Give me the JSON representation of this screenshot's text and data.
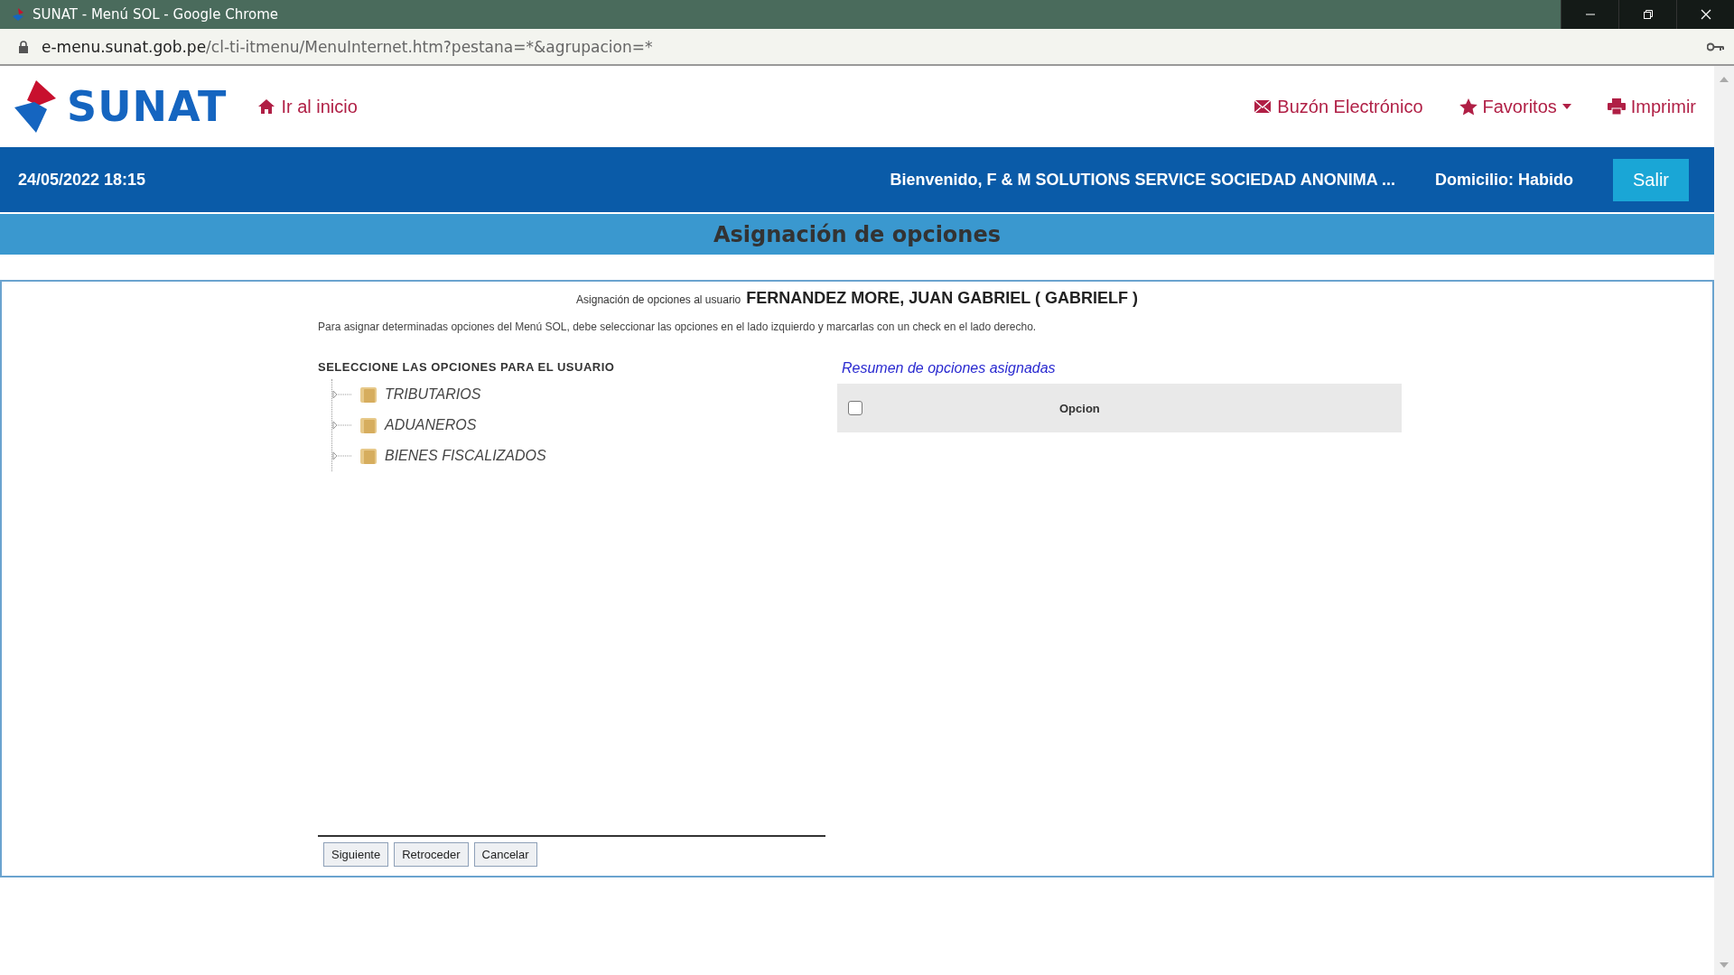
{
  "window": {
    "title": "SUNAT - Menú SOL - Google Chrome"
  },
  "address_bar": {
    "host": "e-menu.sunat.gob.pe",
    "path": "/cl-ti-itmenu/MenuInternet.htm?pestana=*&agrupacion=*"
  },
  "header": {
    "logo": "SUNAT",
    "home_link": "Ir al inicio",
    "links": [
      {
        "kind": "mail",
        "label": "Buzón Electrónico"
      },
      {
        "kind": "star",
        "label": "Favoritos",
        "dropdown": true
      },
      {
        "kind": "print",
        "label": "Imprimir"
      }
    ]
  },
  "user_bar": {
    "datetime": "24/05/2022 18:15",
    "welcome": "Bienvenido, F & M SOLUTIONS SERVICE SOCIEDAD ANONIMA ...",
    "domicile": "Domicilio: Habido",
    "logout": "Salir"
  },
  "page_title": "Asignación de opciones",
  "content": {
    "user_label": "Asignación de opciones al usuario",
    "user_name": "FERNANDEZ MORE, JUAN GABRIEL ( GABRIELF )",
    "instructions": "Para asignar determinadas opciones del Menú SOL, debe seleccionar las opciones en el lado izquierdo y marcarlas con un check en el lado derecho.",
    "tree": {
      "heading": "SELECCIONE LAS OPCIONES PARA EL USUARIO",
      "items": [
        {
          "label": "TRIBUTARIOS"
        },
        {
          "label": "ADUANEROS"
        },
        {
          "label": "BIENES FISCALIZADOS"
        }
      ]
    },
    "summary": {
      "heading": "Resumen de opciones asignadas",
      "select_all_checked": false,
      "columns": [
        "Opcion"
      ]
    },
    "buttons": [
      "Siguiente",
      "Retroceder",
      "Cancelar"
    ]
  }
}
